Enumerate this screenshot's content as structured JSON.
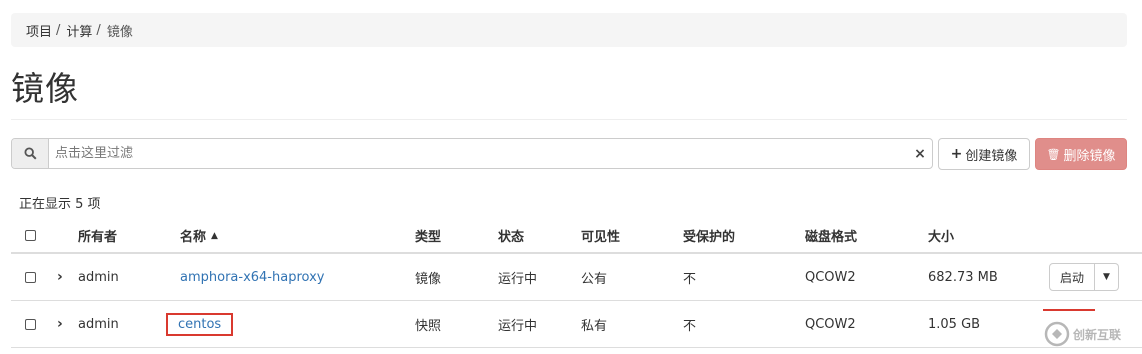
{
  "breadcrumb": [
    "项目",
    "计算",
    "镜像"
  ],
  "page_title": "镜像",
  "search": {
    "placeholder": "点击这里过滤",
    "clear": "×"
  },
  "actions": {
    "create_label": "创建镜像",
    "delete_label": "删除镜像"
  },
  "count_text": "正在显示 5 项",
  "table": {
    "headers": {
      "owner": "所有者",
      "name": "名称",
      "type": "类型",
      "status": "状态",
      "visibility": "可见性",
      "protected": "受保护的",
      "disk_format": "磁盘格式",
      "size": "大小"
    },
    "sort": {
      "column": "name",
      "direction": "asc"
    },
    "rows": [
      {
        "owner": "admin",
        "name": "amphora-x64-haproxy",
        "type": "镜像",
        "status": "运行中",
        "visibility": "公有",
        "protected": "不",
        "disk_format": "QCOW2",
        "size": "682.73 MB",
        "action": "启动"
      },
      {
        "owner": "admin",
        "name": "centos",
        "type": "快照",
        "status": "运行中",
        "visibility": "私有",
        "protected": "不",
        "disk_format": "QCOW2",
        "size": "1.05 GB",
        "highlighted": true
      }
    ]
  },
  "watermark": {
    "text": "创新互联"
  },
  "colors": {
    "link": "#3173b3",
    "delete_bg": "#e08e8b",
    "highlight_border": "#d9392f"
  }
}
